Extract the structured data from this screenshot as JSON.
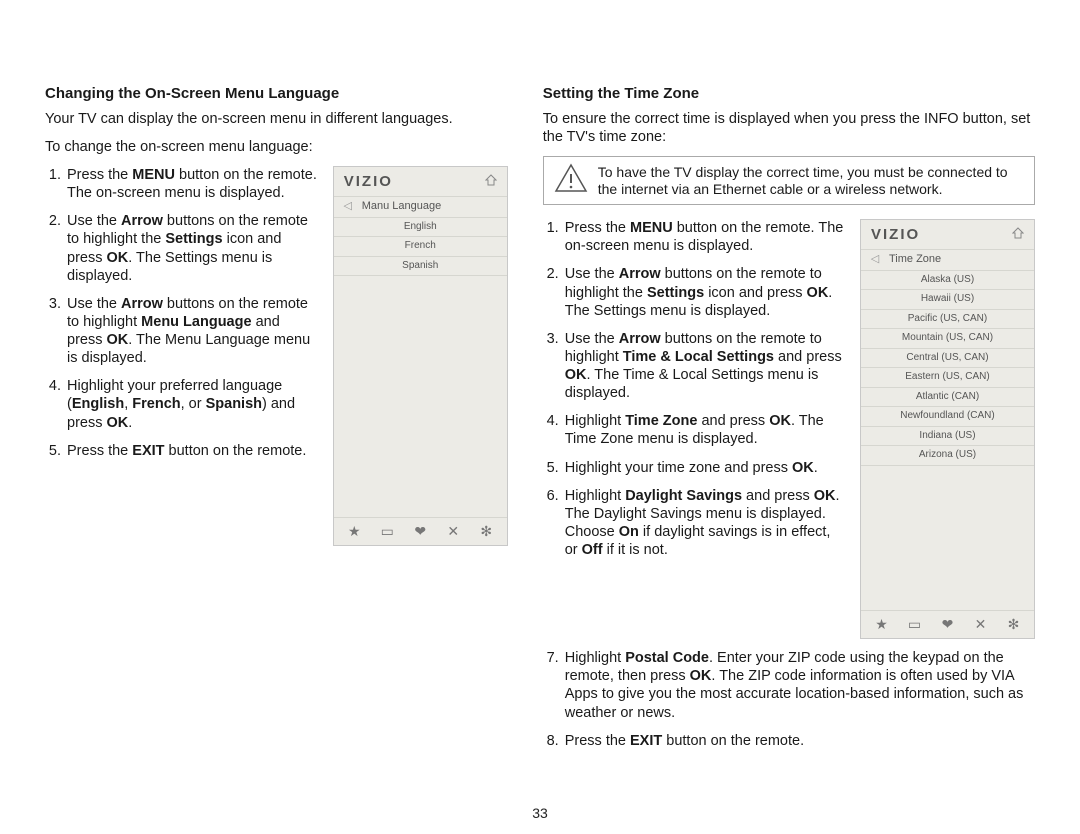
{
  "page_number": "33",
  "left": {
    "heading": "Changing the On-Screen Menu Language",
    "intro1": "Your TV can display the on-screen menu in different languages.",
    "intro2": "To change the on-screen menu language:",
    "steps": {
      "s1_a": "Press the ",
      "s1_b": "MENU",
      "s1_c": " button on the remote. The on-screen menu is displayed.",
      "s2_a": "Use the ",
      "s2_b": "Arrow",
      "s2_c": " buttons on the remote to highlight the ",
      "s2_d": "Settings",
      "s2_e": " icon and press ",
      "s2_f": "OK",
      "s2_g": ". The Settings menu is displayed.",
      "s3_a": "Use the ",
      "s3_b": "Arrow",
      "s3_c": " buttons on the remote to highlight ",
      "s3_d": "Menu Language",
      "s3_e": " and press ",
      "s3_f": "OK",
      "s3_g": ". The Menu Language menu is displayed.",
      "s4_a": "Highlight your preferred language (",
      "s4_b": "English",
      "s4_c": ", ",
      "s4_d": "French",
      "s4_e": ", or ",
      "s4_f": "Spanish",
      "s4_g": ") and press ",
      "s4_h": "OK",
      "s4_i": ".",
      "s5_a": "Press the ",
      "s5_b": "EXIT",
      "s5_c": " button on the remote."
    }
  },
  "right": {
    "heading": "Setting the Time Zone",
    "intro": "To ensure the correct time is displayed when you press the INFO button, set the TV's time zone:",
    "warn": "To have the TV display the correct time, you must be connected to the internet via an Ethernet cable or a wireless network.",
    "steps": {
      "s1_a": "Press the ",
      "s1_b": "MENU",
      "s1_c": " button on the remote. The on-screen menu is displayed.",
      "s2_a": "Use the ",
      "s2_b": "Arrow",
      "s2_c": " buttons on the remote to highlight the ",
      "s2_d": "Settings",
      "s2_e": " icon and press ",
      "s2_f": "OK",
      "s2_g": ". The Settings menu is displayed.",
      "s3_a": "Use the ",
      "s3_b": "Arrow",
      "s3_c": " buttons on the remote to highlight ",
      "s3_d": "Time & Local Settings",
      "s3_e": " and press ",
      "s3_f": "OK",
      "s3_g": ". The Time & Local Settings menu is displayed.",
      "s4_a": "Highlight ",
      "s4_b": "Time Zone",
      "s4_c": " and press ",
      "s4_d": "OK",
      "s4_e": ". The Time Zone menu is displayed.",
      "s5_a": "Highlight your time zone and press ",
      "s5_b": "OK",
      "s5_c": ".",
      "s6_a": "Highlight ",
      "s6_b": "Daylight Savings",
      "s6_c": " and press ",
      "s6_d": "OK",
      "s6_e": ". The Daylight Savings menu is displayed. Choose ",
      "s6_f": "On",
      "s6_g": " if daylight savings is in effect, or ",
      "s6_h": "Off",
      "s6_i": " if it is not.",
      "s7_a": "Highlight ",
      "s7_b": "Postal Code",
      "s7_c": ". Enter your ZIP code using the keypad on the remote, then press ",
      "s7_d": "OK",
      "s7_e": ". The ZIP code information is often used by VIA Apps to give you the most accurate location-based information, such as weather or news.",
      "s8_a": "Press the ",
      "s8_b": "EXIT",
      "s8_c": " button on the remote."
    }
  },
  "panel_lang": {
    "brand": "VIZIO",
    "menu_title": "Manu Language",
    "options": [
      "English",
      "French",
      "Spanish"
    ]
  },
  "panel_tz": {
    "brand": "VIZIO",
    "menu_title": "Time Zone",
    "options": [
      "Alaska (US)",
      "Hawaii (US)",
      "Pacific (US, CAN)",
      "Mountain (US, CAN)",
      "Central (US, CAN)",
      "Eastern (US, CAN)",
      "Atlantic (CAN)",
      "Newfoundland (CAN)",
      "Indiana (US)",
      "Arizona (US)"
    ]
  },
  "footer_icons": {
    "star": "★",
    "cc": "▭",
    "v": "❤",
    "x": "✕",
    "gear": "✻"
  }
}
